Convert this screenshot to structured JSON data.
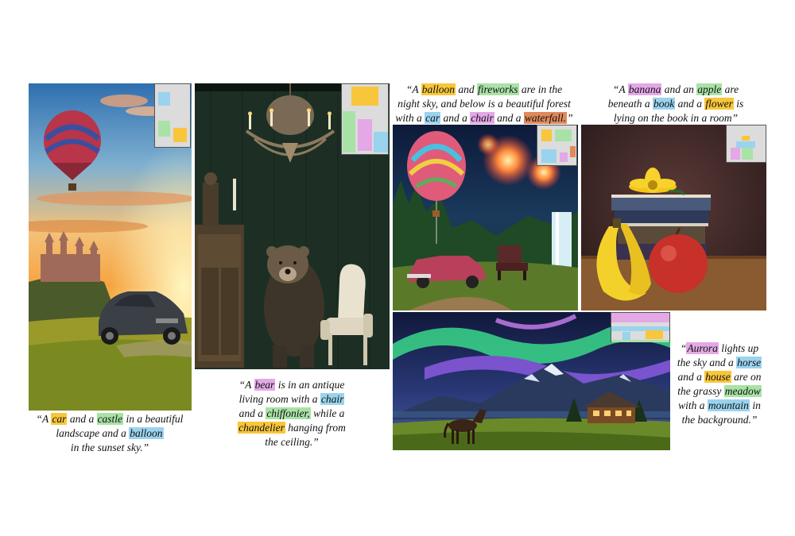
{
  "colors": {
    "yellow": "#f8c63a",
    "green": "#a9e2a6",
    "blue": "#9ad3ee",
    "pink": "#e4a8e6",
    "orange": "#e08a5c",
    "layout_bg": "#dcdcdc"
  },
  "captions": {
    "castle": [
      "“A ",
      {
        "t": "car",
        "c": "yellow"
      },
      " and a ",
      {
        "t": "castle",
        "c": "green"
      },
      " in a beautiful",
      "\n",
      "landscape and a ",
      {
        "t": "balloon",
        "c": "blue"
      },
      "\n",
      "in the sunset sky.”"
    ],
    "bear": [
      "“A ",
      {
        "t": "bear",
        "c": "pink"
      },
      " is in an antique",
      "\n",
      "living room with a ",
      {
        "t": "chair",
        "c": "blue"
      },
      "\n",
      "and a ",
      {
        "t": "chiffonier,",
        "c": "green"
      },
      " while a",
      "\n",
      {
        "t": "chandelier",
        "c": "yellow"
      },
      " hanging from",
      "\n",
      "the ceiling.”"
    ],
    "fireworks": [
      "“A ",
      {
        "t": "balloon",
        "c": "yellow"
      },
      " and ",
      {
        "t": "fireworks",
        "c": "green"
      },
      " are in the",
      "\n",
      "night sky, and below is a beautiful forest",
      "\n",
      "with a ",
      {
        "t": "car",
        "c": "blue"
      },
      " and a ",
      {
        "t": "chair",
        "c": "pink"
      },
      " and a ",
      {
        "t": "waterfall.",
        "c": "orange"
      },
      "”"
    ],
    "banana": [
      "“A ",
      {
        "t": "banana",
        "c": "pink"
      },
      " and an ",
      {
        "t": "apple",
        "c": "green"
      },
      " are",
      "\n",
      "beneath a ",
      {
        "t": "book",
        "c": "blue"
      },
      " and a ",
      {
        "t": "flower",
        "c": "yellow"
      },
      " is",
      "\n",
      "lying on the book in a room”"
    ],
    "aurora": [
      "“",
      {
        "t": "Aurora",
        "c": "pink"
      },
      " lights up",
      "\n",
      "the sky and a ",
      {
        "t": "horse",
        "c": "blue"
      },
      "\n",
      "and a ",
      {
        "t": "house",
        "c": "yellow"
      },
      " are on",
      "\n",
      "the grassy ",
      {
        "t": "meadow",
        "c": "green"
      },
      "\n",
      "with a ",
      {
        "t": "mountain",
        "c": "blue"
      },
      " in",
      "\n",
      "the background.”"
    ]
  }
}
